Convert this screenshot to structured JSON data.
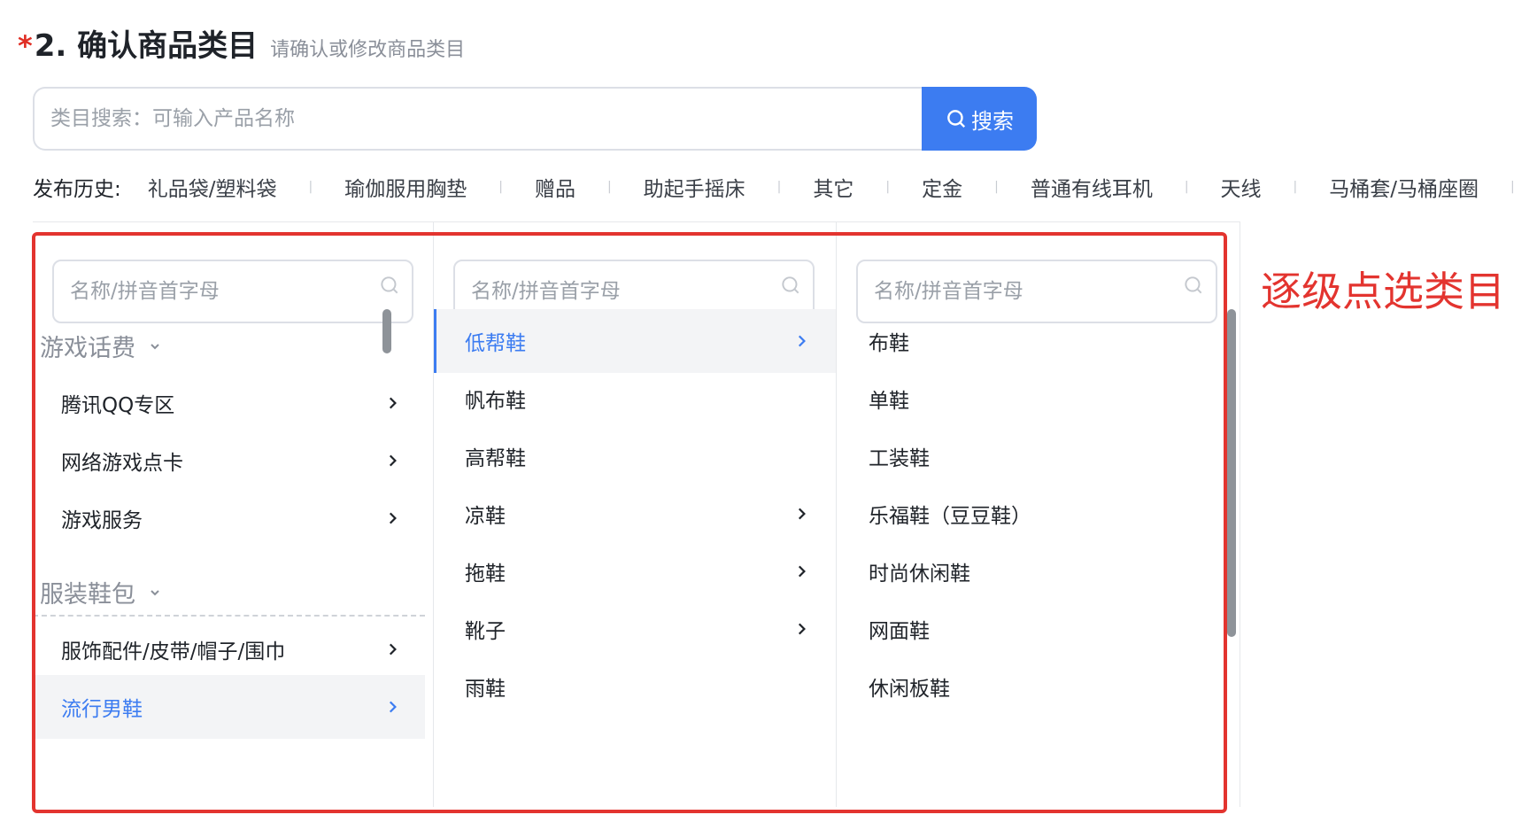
{
  "section": {
    "required_mark": "*",
    "title": "2. 确认商品类目",
    "hint": "请确认或修改商品类目"
  },
  "search": {
    "placeholder": "类目搜索：可输入产品名称",
    "button_label": "搜索"
  },
  "history": {
    "label": "发布历史:",
    "items": [
      "礼品袋/塑料袋",
      "瑜伽服用胸垫",
      "赠品",
      "助起手摇床",
      "其它",
      "定金",
      "普通有线耳机",
      "天线",
      "马桶套/马桶座圈"
    ]
  },
  "cascader": {
    "filter_placeholder": "名称/拼音首字母",
    "column1": {
      "groups": [
        {
          "label": "游戏话费",
          "items": [
            "腾讯QQ专区",
            "网络游戏点卡",
            "游戏服务"
          ]
        },
        {
          "label": "服装鞋包",
          "items": [
            "服饰配件/皮带/帽子/围巾",
            "流行男鞋"
          ]
        }
      ],
      "selected": "流行男鞋"
    },
    "column2": {
      "items": [
        "低帮鞋",
        "帆布鞋",
        "高帮鞋",
        "凉鞋",
        "拖鞋",
        "靴子",
        "雨鞋"
      ],
      "selected": "低帮鞋"
    },
    "column3": {
      "items": [
        "布鞋",
        "单鞋",
        "工装鞋",
        "乐福鞋（豆豆鞋）",
        "时尚休闲鞋",
        "网面鞋",
        "休闲板鞋"
      ]
    }
  },
  "annotation": {
    "text": "逐级点选类目",
    "color": "#e3342f"
  },
  "colors": {
    "accent": "#3c7cf1",
    "required": "#e02e24"
  }
}
